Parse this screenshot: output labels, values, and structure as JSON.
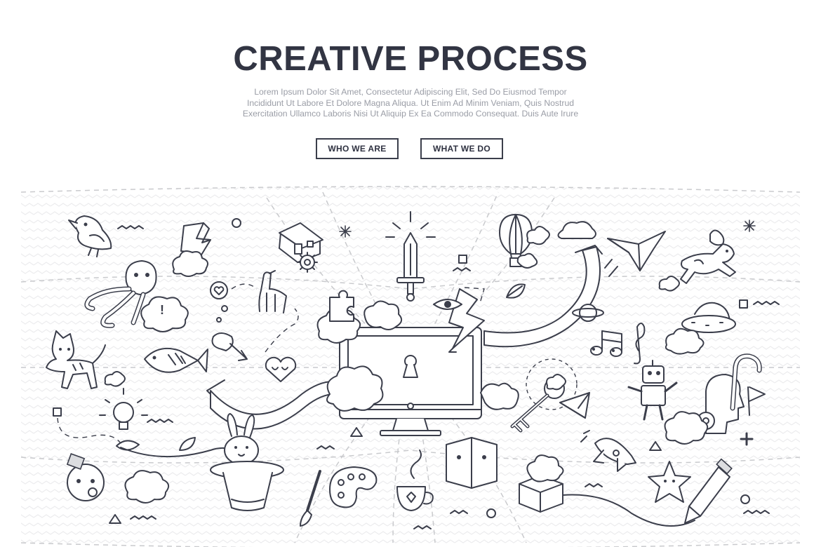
{
  "hero": {
    "title": "CREATIVE PROCESS",
    "subtitle_lines": [
      "Lorem Ipsum Dolor Sit Amet, Consectetur Adipiscing Elit, Sed Do Eiusmod Tempor",
      "Incididunt Ut Labore Et Dolore Magna Aliqua. Ut Enim Ad Minim Veniam, Quis Nostrud",
      "Exercitation Ullamco Laboris Nisi Ut Aliquip Ex Ea Commodo Consequat. Duis Aute Irure"
    ],
    "buttons": {
      "who_label": "WHO WE ARE",
      "what_label": "WHAT WE DO"
    }
  },
  "illustration": {
    "icons": [
      "bird-icon",
      "lightning-icon",
      "house-icon",
      "sword-icon",
      "hot-air-balloon-icon",
      "cloud-icon",
      "paper-crane-icon",
      "dog-icon",
      "octopus-icon",
      "dinosaur-icon",
      "puzzle-icon",
      "eye-icon",
      "leaf-icon",
      "ribbon-icon",
      "ufo-icon",
      "cat-icon",
      "fish-icon",
      "heart-icon",
      "monitor-icon",
      "keyhole-icon",
      "music-note-icon",
      "key-icon",
      "paper-plane-icon",
      "robot-icon",
      "head-gears-icon",
      "lightbulb-icon",
      "rabbit-hat-icon",
      "palette-icon",
      "brush-icon",
      "coffee-cup-icon",
      "book-icon",
      "gift-box-icon",
      "rocket-icon",
      "star-icon",
      "pencil-icon",
      "gear-icon"
    ]
  }
}
